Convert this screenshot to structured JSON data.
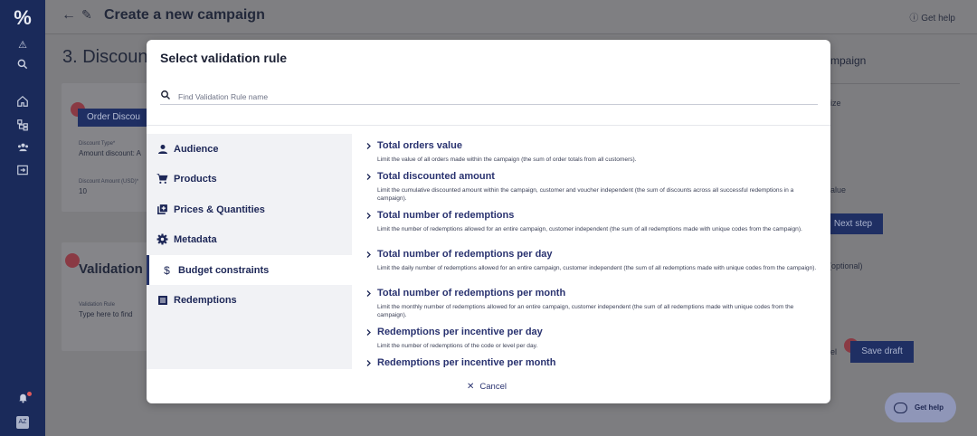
{
  "header": {
    "title": "Create a new campaign",
    "help_label": "Get help"
  },
  "background": {
    "step_title": "3. Discoun",
    "chip_label": "Order Discou",
    "discount_type_label": "Discount Type*",
    "discount_type_value": "Amount discount: A",
    "discount_amount_label": "Discount Amount (USD)*",
    "discount_amount_value": "10",
    "validation_title": "Validation",
    "validation_rule_label": "Validation Rule",
    "validation_rule_placeholder": "Type here to find",
    "right_title": "mpaign",
    "right_txt_1": "ize",
    "right_txt_2": "alue",
    "right_txt_3": "(optional)",
    "right_txt_4": "el",
    "next_step_label": "Next step",
    "save_draft_label": "Save draft"
  },
  "modal": {
    "title": "Select validation rule",
    "search_placeholder": "Find Validation Rule name",
    "categories": [
      {
        "label": "Audience",
        "icon": "person-icon"
      },
      {
        "label": "Products",
        "icon": "cart-icon"
      },
      {
        "label": "Prices & Quantities",
        "icon": "library-add-icon"
      },
      {
        "label": "Metadata",
        "icon": "gear-icon"
      },
      {
        "label": "Budget constraints",
        "icon": "dollar-icon",
        "active": true
      },
      {
        "label": "Redemptions",
        "icon": "list-icon"
      }
    ],
    "rules": [
      {
        "name": "Total orders value",
        "desc": "Limit the value of all orders made within the campaign (the sum of order totals from all customers)."
      },
      {
        "name": "Total discounted amount",
        "desc": "Limit the cumulative discounted amount within the campaign, customer and voucher independent (the sum of discounts across all successful redemptions in a campaign)."
      },
      {
        "name": "Total number of redemptions",
        "desc": "Limit the number of redemptions allowed for an entire campaign, customer independent (the sum of all redemptions made with unique codes from the campaign)."
      },
      {
        "name": "Total number of redemptions per day",
        "desc": "Limit the daily number of redemptions allowed for an entire campaign, customer independent (the sum of all redemptions made with unique codes from the campaign)."
      },
      {
        "name": "Total number of redemptions per month",
        "desc": "Limit the monthly number of redemptions allowed for an entire campaign, customer independent (the sum of all redemptions made with unique codes from the campaign)."
      },
      {
        "name": "Redemptions per incentive per day",
        "desc": "Limit the number of redemptions of the code or level per day."
      },
      {
        "name": "Redemptions per incentive per month",
        "desc": ""
      }
    ],
    "cancel_label": "Cancel"
  },
  "fab": {
    "label": "Get help"
  },
  "colors": {
    "nav": "#1a2a5a",
    "accent": "#243268",
    "overlay_bg": "#7d7d80"
  }
}
